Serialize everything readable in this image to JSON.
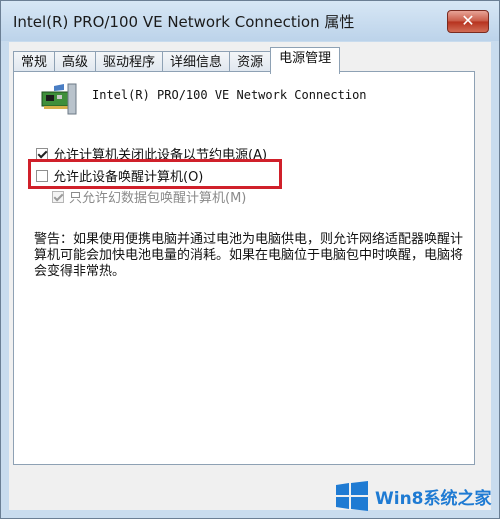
{
  "window": {
    "title": "Intel(R) PRO/100 VE Network Connection 属性",
    "close_label": "✕"
  },
  "tabs": [
    {
      "label": "常规"
    },
    {
      "label": "高级"
    },
    {
      "label": "驱动程序"
    },
    {
      "label": "详细信息"
    },
    {
      "label": "资源"
    },
    {
      "label": "电源管理",
      "active": true
    }
  ],
  "device": {
    "icon": "network-adapter-icon",
    "name": "Intel(R) PRO/100 VE Network Connection"
  },
  "options": {
    "allow_power_off": {
      "label": "允许计算机关闭此设备以节约电源(A)",
      "checked": true,
      "enabled": true
    },
    "allow_wake": {
      "label": "允许此设备唤醒计算机(O)",
      "checked": false,
      "enabled": true
    },
    "magic_packet_only": {
      "label": "只允许幻数据包唤醒计算机(M)",
      "checked": true,
      "enabled": false
    }
  },
  "warning": "警告：如果使用便携电脑并通过电池为电脑供电，则允许网络适配器唤醒计算机可能会加快电池电量的消耗。如果在电脑位于电脑包中时唤醒，电脑将会变得非常热。",
  "watermark": {
    "text": "Win8系统之家",
    "logo_icon": "windows-logo-icon",
    "color": "#1f7bd3"
  },
  "colors": {
    "highlight_box": "#d0202a"
  }
}
